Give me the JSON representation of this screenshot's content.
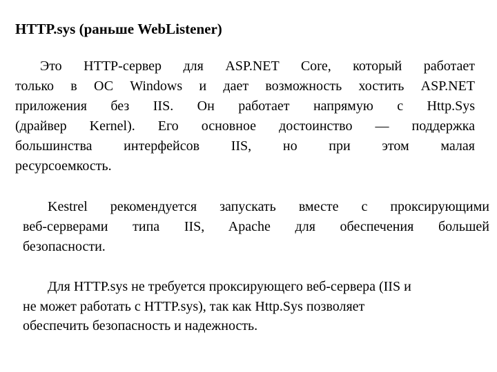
{
  "title": "HTTP.sys (раньше WebListener)",
  "paragraphs": [
    {
      "lines": [
        "Это HTTP-сервер для ASP.NET Core, который работает",
        "только в ОС Windows и дает возможность хостить ASP.NET",
        "приложения без IIS. Он работает напрямую с Http.Sys",
        "(драйвер Kernel). Его основное достоинство — поддержка",
        "большинства интерфейсов IIS, но при этом малая",
        "ресурсоемкость."
      ]
    },
    {
      "lines": [
        "Kestrel рекомендуется запускать вместе с проксирующими",
        "веб-серверами типа IIS, Apache для обеспечения большей",
        "безопасности."
      ]
    },
    {
      "lines": [
        "Для HTTP.sys не требуется проксирующего веб-сервера (IIS и",
        "не может работать с HTTP.sys), так как Http.Sys позволяет",
        "обеспечить безопасность и надежность."
      ]
    }
  ]
}
